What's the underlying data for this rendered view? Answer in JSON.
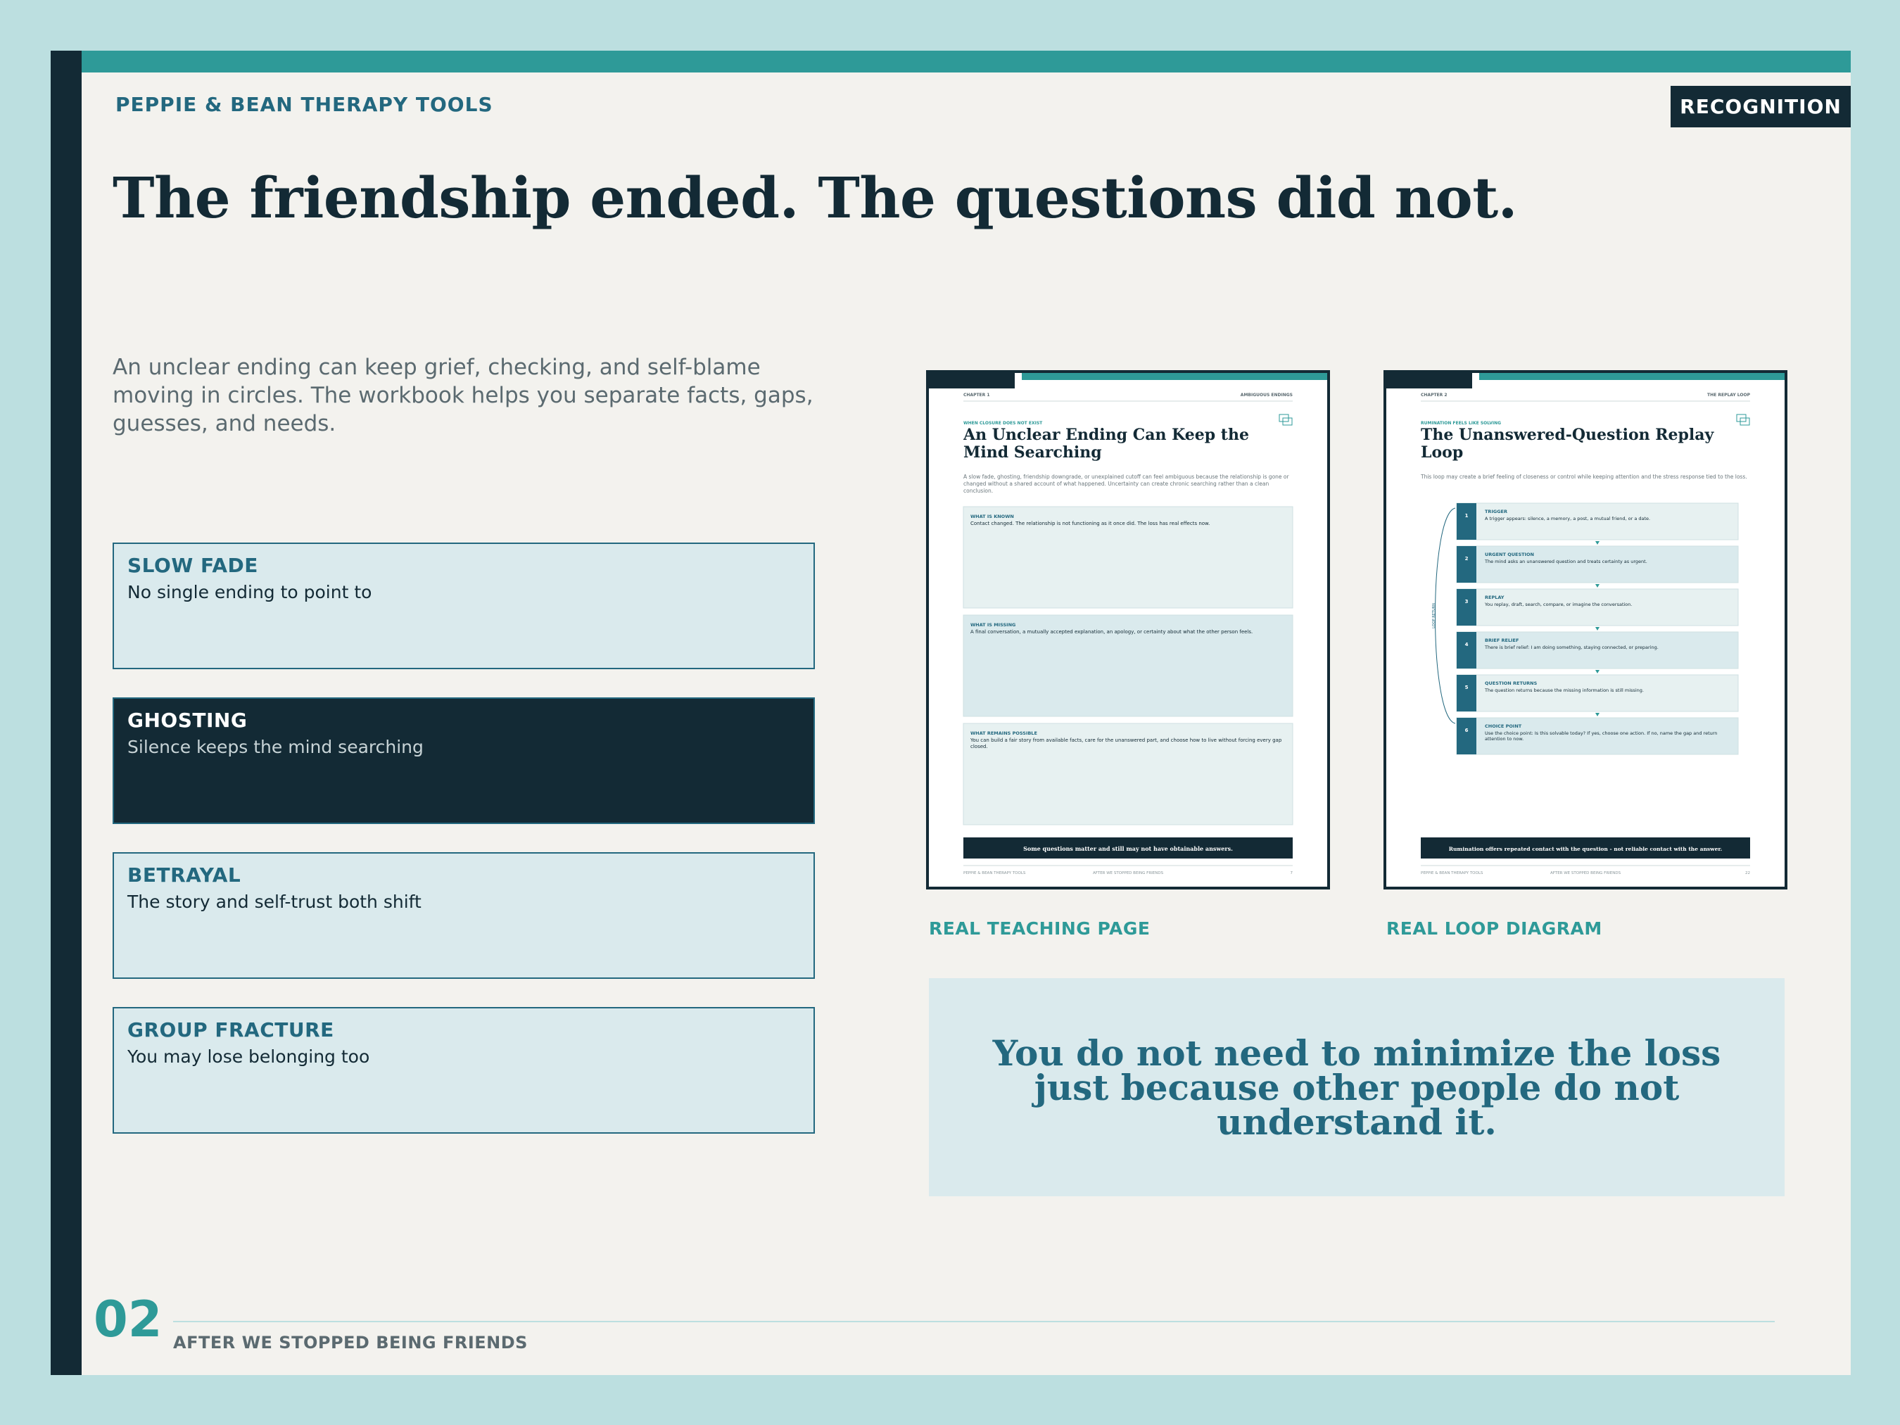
{
  "header": {
    "brand": "PEPPIE & BEAN THERAPY TOOLS",
    "tag": "RECOGNITION"
  },
  "headline": "The friendship ended. The questions did not.",
  "intro": "An unclear ending can keep grief, checking, and self-blame moving in circles. The workbook helps you separate facts, gaps, guesses, and needs.",
  "cards": [
    {
      "title": "SLOW FADE",
      "subtitle": "No single ending to point to"
    },
    {
      "title": "GHOSTING",
      "subtitle": "Silence keeps the mind searching"
    },
    {
      "title": "BETRAYAL",
      "subtitle": "The story and self-trust both shift"
    },
    {
      "title": "GROUP FRACTURE",
      "subtitle": "You may lose belonging too"
    }
  ],
  "thumb1": {
    "chapter": "CHAPTER 1",
    "section": "AMBIGUOUS ENDINGS",
    "kicker": "WHEN CLOSURE DOES NOT EXIST",
    "title": "An Unclear Ending Can Keep the Mind Searching",
    "intro": "A slow fade, ghosting, friendship downgrade, or unexplained cutoff can feel ambiguous because the relationship is gone or changed without a shared account of what happened. Uncertainty can create chronic searching rather than a clean conclusion.",
    "panels": [
      {
        "title": "WHAT IS KNOWN",
        "text": "Contact changed. The relationship is not functioning as it once did. The loss has real effects now."
      },
      {
        "title": "WHAT IS MISSING",
        "text": "A final conversation, a mutually accepted explanation, an apology, or certainty about what the other person feels."
      },
      {
        "title": "WHAT REMAINS POSSIBLE",
        "text": "You can build a fair story from available facts, care for the unanswered part, and choose how to live without forcing every gap closed."
      }
    ],
    "banner": "Some questions matter and still may not have obtainable answers.",
    "footer_left": "PEPPIE & BEAN THERAPY TOOLS",
    "footer_mid": "AFTER WE STOPPED BEING FRIENDS",
    "footer_page": "7"
  },
  "thumb2": {
    "chapter": "CHAPTER 2",
    "section": "THE REPLAY LOOP",
    "kicker": "RUMINATION FEELS LIKE SOLVING",
    "title": "The Unanswered-Question Replay Loop",
    "intro": "This loop may create a brief feeling of closeness or control while keeping attention and the stress response tied to the loss.",
    "loop_label": "LOOP RETURN",
    "steps": [
      {
        "num": "1",
        "title": "TRIGGER",
        "text": "A trigger appears: silence, a memory, a post, a mutual friend, or a date."
      },
      {
        "num": "2",
        "title": "URGENT QUESTION",
        "text": "The mind asks an unanswered question and treats certainty as urgent."
      },
      {
        "num": "3",
        "title": "REPLAY",
        "text": "You replay, draft, search, compare, or imagine the conversation."
      },
      {
        "num": "4",
        "title": "BRIEF RELIEF",
        "text": "There is brief relief: I am doing something, staying connected, or preparing."
      },
      {
        "num": "5",
        "title": "QUESTION RETURNS",
        "text": "The question returns because the missing information is still missing."
      },
      {
        "num": "6",
        "title": "CHOICE POINT",
        "text": "Use the choice point: Is this solvable today? If yes, choose one action. If no, name the gap and return attention to now."
      }
    ],
    "banner": "Rumination offers repeated contact with the question - not reliable contact with the answer.",
    "footer_left": "PEPPIE & BEAN THERAPY TOOLS",
    "footer_mid": "AFTER WE STOPPED BEING FRIENDS",
    "footer_page": "22"
  },
  "captions": {
    "thumb1": "REAL TEACHING PAGE",
    "thumb2": "REAL LOOP DIAGRAM"
  },
  "quote": "You do not need to minimize the loss just because other people do not understand it.",
  "footer": {
    "page_number": "02",
    "title": "AFTER WE STOPPED BEING FRIENDS"
  },
  "colors": {
    "navy": "#132a35",
    "teal": "#2e9a98",
    "deep_teal": "#23687f",
    "pale_blue": "#daeaed",
    "background": "#f3f2ee"
  }
}
